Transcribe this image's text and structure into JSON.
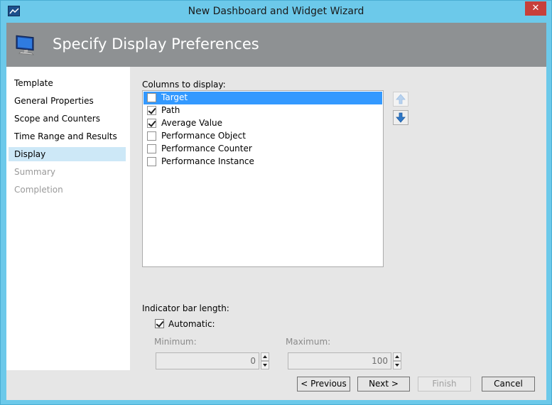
{
  "window": {
    "title": "New Dashboard and Widget Wizard",
    "close_glyph": "✕"
  },
  "banner": {
    "title": "Specify Display Preferences",
    "icon": "monitor-icon"
  },
  "nav": {
    "items": [
      {
        "label": "Template",
        "state": "normal"
      },
      {
        "label": "General Properties",
        "state": "normal"
      },
      {
        "label": "Scope and Counters",
        "state": "normal"
      },
      {
        "label": "Time Range and Results",
        "state": "normal"
      },
      {
        "label": "Display",
        "state": "selected"
      },
      {
        "label": "Summary",
        "state": "disabled"
      },
      {
        "label": "Completion",
        "state": "disabled"
      }
    ]
  },
  "columns": {
    "label": "Columns to display:",
    "items": [
      {
        "label": "Target",
        "checked": false,
        "selected": true
      },
      {
        "label": "Path",
        "checked": true,
        "selected": false
      },
      {
        "label": "Average Value",
        "checked": true,
        "selected": false
      },
      {
        "label": "Performance Object",
        "checked": false,
        "selected": false
      },
      {
        "label": "Performance Counter",
        "checked": false,
        "selected": false
      },
      {
        "label": "Performance Instance",
        "checked": false,
        "selected": false
      }
    ],
    "move_up_icon": "arrow-up-icon",
    "move_down_icon": "arrow-down-icon"
  },
  "indicator": {
    "label": "Indicator bar length:",
    "automatic_label": "Automatic:",
    "automatic_checked": true,
    "minimum_label": "Minimum:",
    "minimum_value": "0",
    "maximum_label": "Maximum:",
    "maximum_value": "100"
  },
  "buttons": {
    "previous": "< Previous",
    "next": "Next >",
    "finish": "Finish",
    "cancel": "Cancel"
  },
  "colors": {
    "titlebar": "#6cc9ea",
    "banner": "#8e9193",
    "selection": "#3399ff",
    "nav_selected": "#cde8f7",
    "close": "#c7403a"
  }
}
